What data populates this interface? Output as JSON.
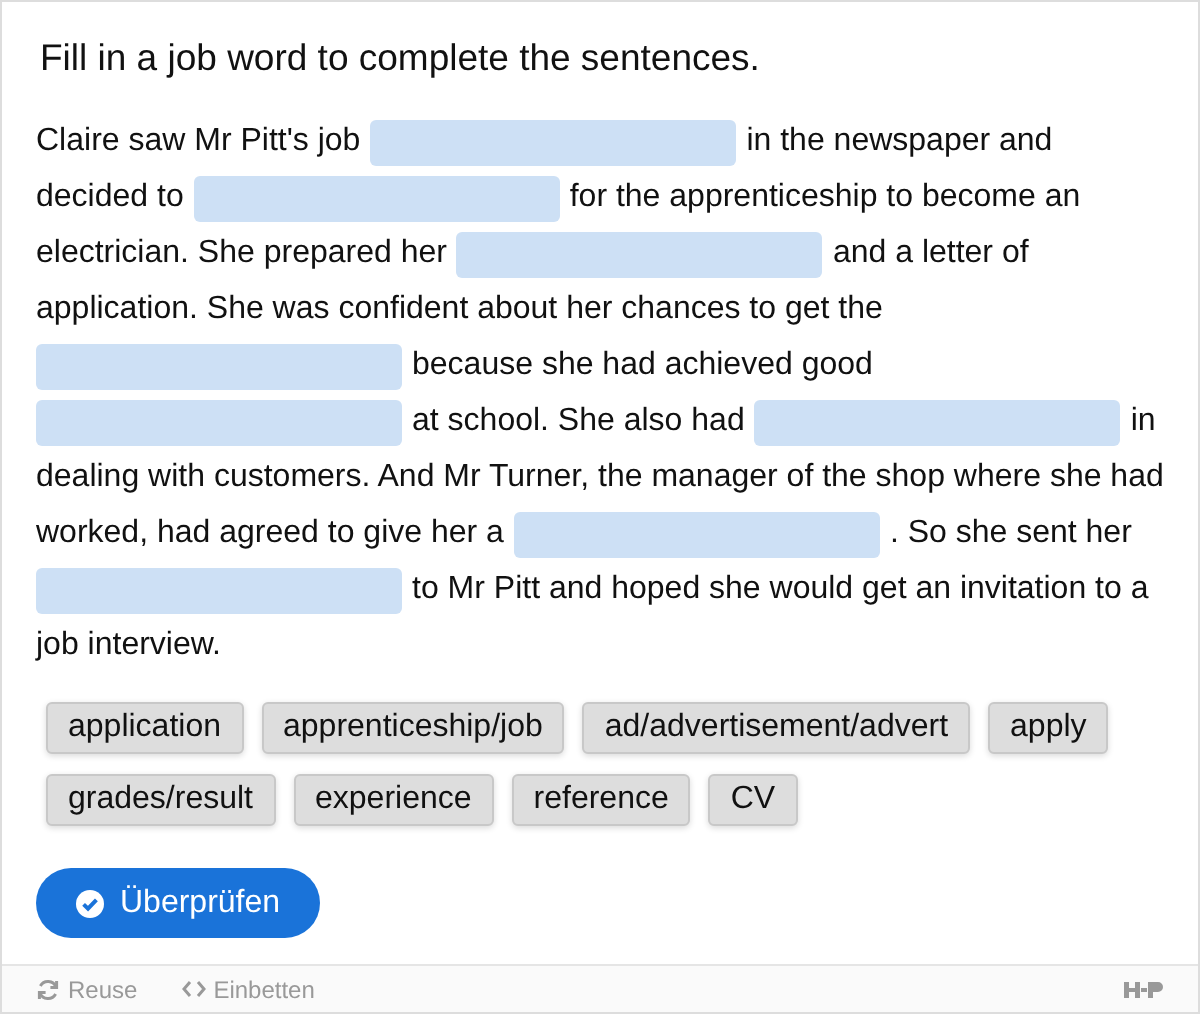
{
  "title": "Fill in a job word to complete the sentences.",
  "lines": [
    [
      {
        "kind": "text",
        "text": "Claire saw Mr Pitt's job"
      },
      {
        "kind": "blank"
      },
      {
        "kind": "text",
        "text": "in the newspaper and"
      }
    ],
    [
      {
        "kind": "text",
        "text": "decided to"
      },
      {
        "kind": "blank"
      },
      {
        "kind": "text",
        "text": "for the apprenticeship to become an"
      }
    ],
    [
      {
        "kind": "text",
        "text": "electrician. She prepared her"
      },
      {
        "kind": "blank"
      },
      {
        "kind": "text",
        "text": "and a letter of"
      }
    ],
    [
      {
        "kind": "text",
        "text": "application. She was confident about her chances to get the"
      }
    ],
    [
      {
        "kind": "blank"
      },
      {
        "kind": "text",
        "text": "because she had achieved good"
      }
    ],
    [
      {
        "kind": "blank"
      },
      {
        "kind": "text",
        "text": "at school. She also had"
      },
      {
        "kind": "blank"
      },
      {
        "kind": "text",
        "text": "in"
      }
    ],
    [
      {
        "kind": "text",
        "text": "dealing with customers. And Mr Turner, the manager of the shop where she had"
      }
    ],
    [
      {
        "kind": "text",
        "text": "worked, had agreed to give her a"
      },
      {
        "kind": "blank"
      },
      {
        "kind": "text",
        "text": ". So she sent her"
      }
    ],
    [
      {
        "kind": "blank"
      },
      {
        "kind": "text",
        "text": "to Mr Pitt and hoped she would get an invitation to a"
      }
    ],
    [
      {
        "kind": "text",
        "text": "job interview."
      }
    ]
  ],
  "words": [
    "application",
    "apprenticeship/job",
    "ad/advertisement/advert",
    "apply",
    "grades/result",
    "experience",
    "reference",
    "CV"
  ],
  "check_button": "Überprüfen",
  "footer": {
    "reuse": "Reuse",
    "embed": "Einbetten"
  }
}
